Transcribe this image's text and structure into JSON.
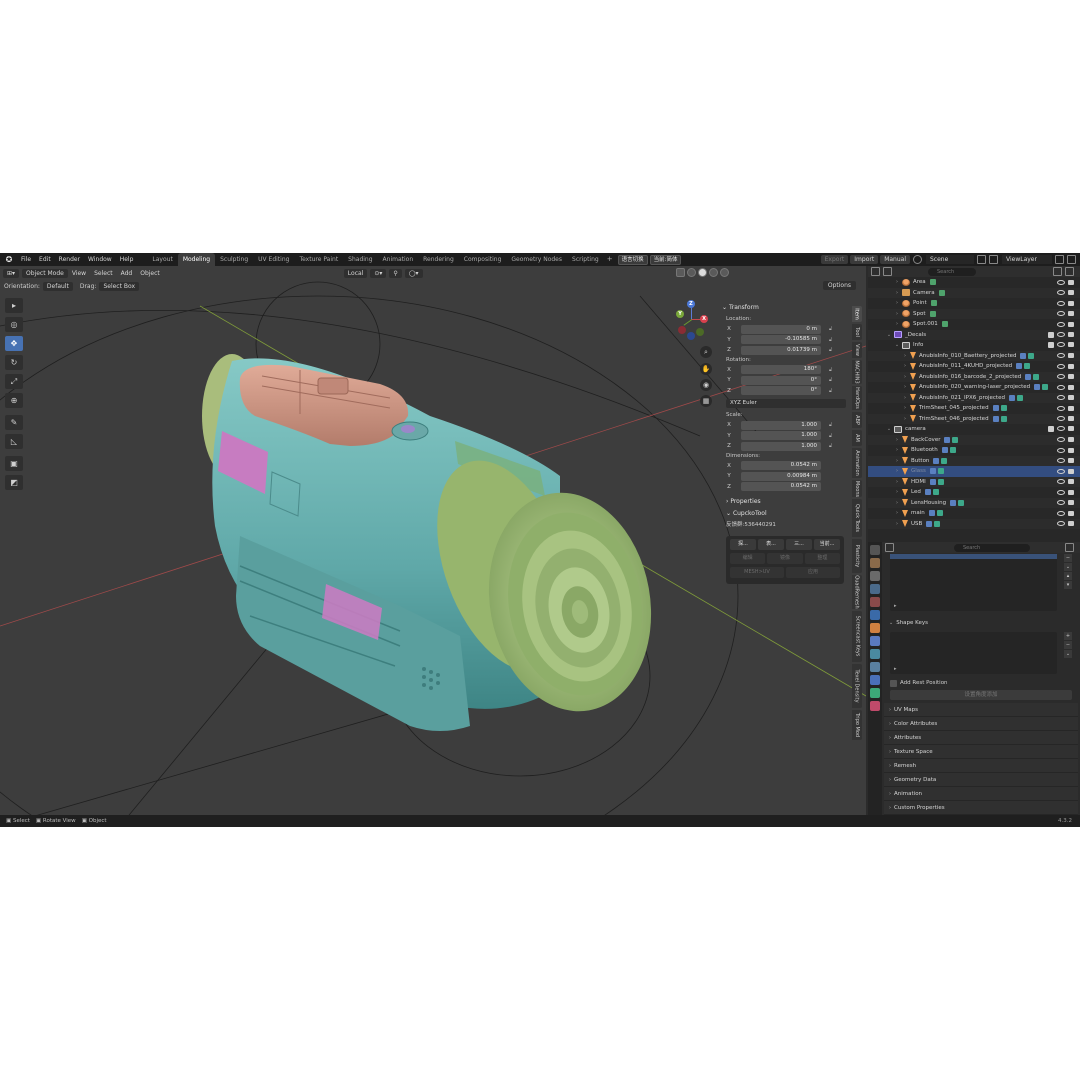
{
  "menu": [
    "File",
    "Edit",
    "Render",
    "Window",
    "Help"
  ],
  "workspaces": [
    {
      "label": "Layout",
      "active": false
    },
    {
      "label": "Modeling",
      "active": true
    },
    {
      "label": "Sculpting",
      "active": false
    },
    {
      "label": "UV Editing",
      "active": false
    },
    {
      "label": "Texture Paint",
      "active": false
    },
    {
      "label": "Shading",
      "active": false
    },
    {
      "label": "Animation",
      "active": false
    },
    {
      "label": "Rendering",
      "active": false
    },
    {
      "label": "Compositing",
      "active": false
    },
    {
      "label": "Geometry Nodes",
      "active": false
    },
    {
      "label": "Scripting",
      "active": false
    }
  ],
  "cn_buttons": [
    "语言切换",
    "当前:简体"
  ],
  "topright": {
    "export": "Export",
    "import": "Import",
    "manual": "Manual",
    "scene": "Scene",
    "viewlayer": "ViewLayer"
  },
  "viewport_header": {
    "mode": "Object Mode",
    "menus": [
      "View",
      "Select",
      "Add",
      "Object"
    ],
    "transform_orientation": "Local"
  },
  "viewport_header2": {
    "orientation_label": "Orientation:",
    "orientation_value": "Default",
    "drag_label": "Drag:",
    "drag_value": "Select Box",
    "options": "Options"
  },
  "gizmo": {
    "x": "X",
    "y": "Y",
    "z": "Z"
  },
  "npanel": {
    "transform_title": "Transform",
    "location_label": "Location:",
    "location": [
      {
        "axis": "X",
        "value": "0 m"
      },
      {
        "axis": "Y",
        "value": "-0.10585 m"
      },
      {
        "axis": "Z",
        "value": "0.01739 m"
      }
    ],
    "rotation_label": "Rotation:",
    "rotation": [
      {
        "axis": "X",
        "value": "180°"
      },
      {
        "axis": "Y",
        "value": "0°"
      },
      {
        "axis": "Z",
        "value": "0°"
      }
    ],
    "rotation_mode": "XYZ Euler",
    "scale_label": "Scale:",
    "scale": [
      {
        "axis": "X",
        "value": "1.000"
      },
      {
        "axis": "Y",
        "value": "1.000"
      },
      {
        "axis": "Z",
        "value": "1.000"
      }
    ],
    "dimensions_label": "Dimensions:",
    "dimensions": [
      {
        "axis": "X",
        "value": "0.0542 m"
      },
      {
        "axis": "Y",
        "value": "0.00984 m"
      },
      {
        "axis": "Z",
        "value": "0.0542 m"
      }
    ],
    "properties_title": "Properties",
    "cupcko_title": "CupckoTool",
    "feedback_text": "反馈群:536440291",
    "cupcko_row1": [
      "探...",
      "表...",
      "三...",
      "当前..."
    ],
    "cupcko_row2": [
      "编辑",
      "镜像",
      "整理"
    ],
    "cupcko_row3": [
      "MESH>UV",
      "应用"
    ]
  },
  "ntabs": [
    "Item",
    "Tool",
    "View",
    "MACHIN3",
    "HardOps",
    "ABP",
    "AM",
    "Animation",
    "Moons",
    "Quick Tools",
    "Plasticity",
    "QuadRemesh",
    "Screencast Keys",
    "Texel Density",
    "Tripo Mod"
  ],
  "outliner": {
    "search_placeholder": "Search",
    "rows": [
      {
        "name": "Area",
        "type": "light",
        "indent": 1,
        "extra": "green"
      },
      {
        "name": "Camera",
        "type": "cam",
        "indent": 1,
        "extra": "green"
      },
      {
        "name": "Point",
        "type": "light",
        "indent": 1,
        "extra": "green"
      },
      {
        "name": "Spot",
        "type": "light",
        "indent": 1,
        "extra": "green"
      },
      {
        "name": "Spot.001",
        "type": "light",
        "indent": 1,
        "extra": "green"
      },
      {
        "name": "_Decals",
        "type": "coll-purple",
        "indent": 0,
        "extra": ""
      },
      {
        "name": "Info",
        "type": "coll",
        "indent": 1,
        "extra": ""
      },
      {
        "name": "AnubisInfo_010_Baettery_projected",
        "type": "tri",
        "indent": 2,
        "extra": "blue"
      },
      {
        "name": "AnubisInfo_011_4KUHD_projected",
        "type": "tri",
        "indent": 2,
        "extra": "blue"
      },
      {
        "name": "AnubisInfo_016_barcode_2_projected",
        "type": "tri",
        "indent": 2,
        "extra": "blue"
      },
      {
        "name": "AnubisInfo_020_warning-laser_projected",
        "type": "tri",
        "indent": 2,
        "extra": "blue"
      },
      {
        "name": "AnubisInfo_021_IPX6_projected",
        "type": "tri",
        "indent": 2,
        "extra": "blue"
      },
      {
        "name": "TrimSheet_045_projected",
        "type": "tri",
        "indent": 2,
        "extra": "blue"
      },
      {
        "name": "TrimSheet_046_projected",
        "type": "tri",
        "indent": 2,
        "extra": "blue"
      },
      {
        "name": "camera",
        "type": "coll",
        "indent": 0,
        "extra": ""
      },
      {
        "name": "BackCover",
        "type": "tri",
        "indent": 1,
        "extra": "blue"
      },
      {
        "name": "Bluetooth",
        "type": "tri",
        "indent": 1,
        "extra": "blue"
      },
      {
        "name": "Button",
        "type": "tri",
        "indent": 1,
        "extra": "blue"
      },
      {
        "name": "Glass",
        "type": "tri",
        "indent": 1,
        "extra": "blue",
        "selected": true
      },
      {
        "name": "HDMI",
        "type": "tri",
        "indent": 1,
        "extra": "blue"
      },
      {
        "name": "Led",
        "type": "tri",
        "indent": 1,
        "extra": "blue"
      },
      {
        "name": "LensHousing",
        "type": "tri",
        "indent": 1,
        "extra": "blue"
      },
      {
        "name": "main",
        "type": "tri",
        "indent": 1,
        "extra": "blue"
      },
      {
        "name": "USB",
        "type": "tri",
        "indent": 1,
        "extra": "blue"
      }
    ]
  },
  "properties": {
    "search_placeholder": "Search",
    "shape_keys": "Shape Keys",
    "add_rest_position": "Add Rest Position",
    "apply_shape_btn": "设置角度添加",
    "sections": [
      "UV Maps",
      "Color Attributes",
      "Attributes",
      "Texture Space",
      "Remesh",
      "Geometry Data",
      "Animation",
      "Custom Properties"
    ]
  },
  "statusbar": {
    "select": "Select",
    "rotate": "Rotate View",
    "object": "Object",
    "version": "4.3.2"
  },
  "colors": {
    "accent": "#4772b3",
    "body_teal": "#6fb3b3",
    "lens_green": "#a6c27c",
    "top_salmon": "#c89585",
    "decal_pink": "#c77cc1"
  }
}
